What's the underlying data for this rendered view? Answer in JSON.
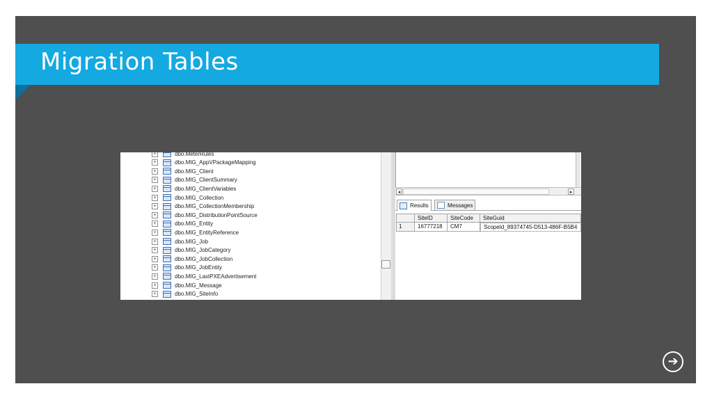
{
  "slide": {
    "title": "Migration Tables",
    "accent_color": "#14a9e1",
    "background_color": "#4f4f4f",
    "next_icon": "arrow-right-circle-icon",
    "next_glyph": "➔"
  },
  "tree": {
    "expander_glyph": "+",
    "items": [
      "dbo.MeterRules",
      "dbo.MIG_AppVPackageMapping",
      "dbo.MIG_Client",
      "dbo.MIG_ClientSummary",
      "dbo.MIG_ClientVariables",
      "dbo.MIG_Collection",
      "dbo.MIG_CollectionMembership",
      "dbo.MIG_DistributionPointSource",
      "dbo.MIG_Entity",
      "dbo.MIG_EntityReference",
      "dbo.MIG_Job",
      "dbo.MIG_JobCategory",
      "dbo.MIG_JobCollection",
      "dbo.MIG_JobEntity",
      "dbo.MIG_LastPXEAdvertisement",
      "dbo.MIG_Message",
      "dbo.MIG_SiteInfo"
    ]
  },
  "scroll": {
    "left_glyph": "◂",
    "right_glyph": "▸"
  },
  "tabs": {
    "results": "Results",
    "messages": "Messages"
  },
  "grid": {
    "columns": [
      "",
      "SiteID",
      "SiteCode",
      "SiteGuid"
    ],
    "rows": [
      [
        "1",
        "16777218",
        "CM7",
        "ScopeId_89374745-D513-486F-B5B4"
      ]
    ]
  }
}
